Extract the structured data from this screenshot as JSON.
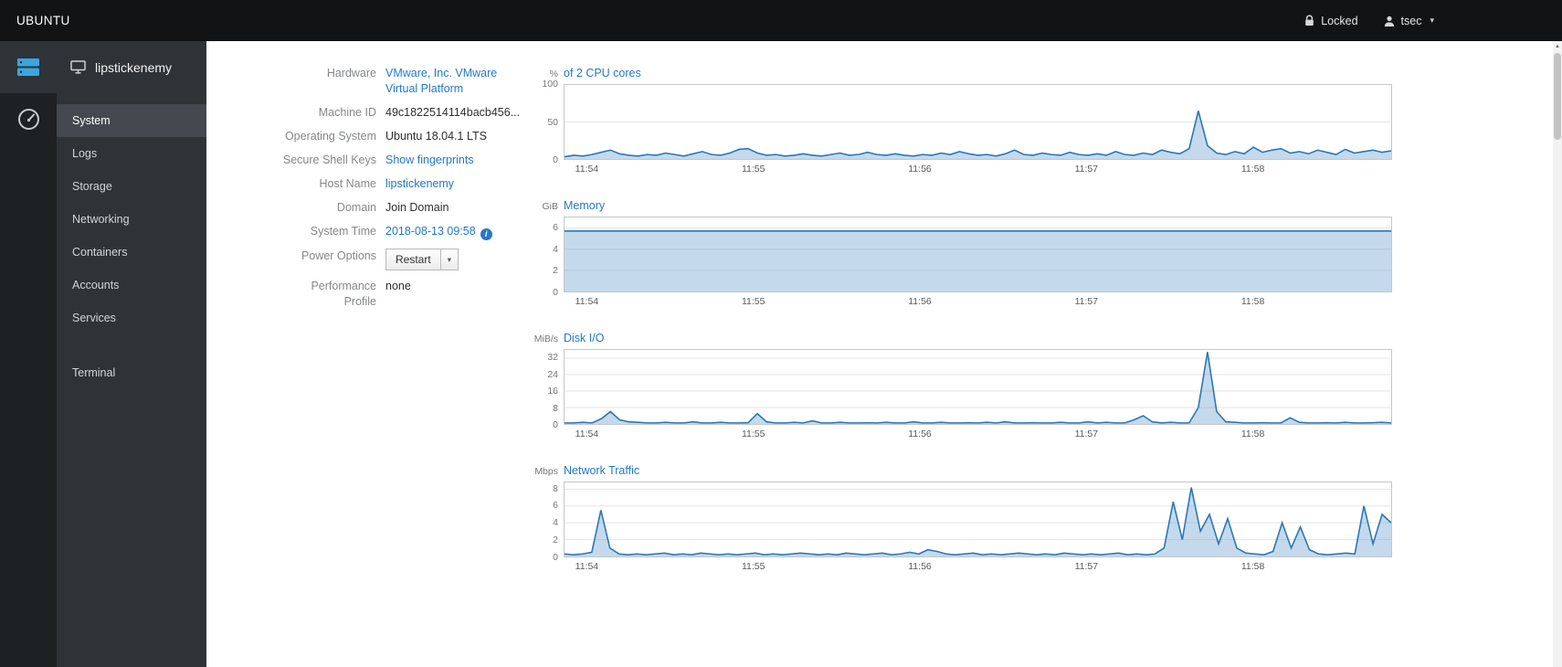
{
  "masthead": {
    "brand": "UBUNTU",
    "locked": "Locked",
    "user": "tsec"
  },
  "sidebar": {
    "host": "lipstickenemy",
    "items": [
      {
        "label": "System",
        "active": true
      },
      {
        "label": "Logs"
      },
      {
        "label": "Storage"
      },
      {
        "label": "Networking"
      },
      {
        "label": "Containers"
      },
      {
        "label": "Accounts"
      },
      {
        "label": "Services"
      }
    ],
    "tools": [
      {
        "label": "Terminal"
      }
    ]
  },
  "info": {
    "rows": [
      {
        "label": "Hardware",
        "value": "VMware, Inc. VMware Virtual Platform",
        "link": true,
        "wrap": true
      },
      {
        "label": "Machine ID",
        "value": "49c1822514114bacb456..."
      },
      {
        "label": "Operating System",
        "value": "Ubuntu 18.04.1 LTS"
      },
      {
        "label": "Secure Shell Keys",
        "value": "Show fingerprints",
        "link": true
      },
      {
        "label": "Host Name",
        "value": "lipstickenemy",
        "link": true
      },
      {
        "label": "Domain",
        "value": "Join Domain"
      },
      {
        "label": "System Time",
        "value": "2018-08-13 09:58",
        "link": true,
        "info_icon": true
      },
      {
        "label": "Power Options",
        "button": "Restart"
      },
      {
        "label": "Performance Profile",
        "value": "none"
      }
    ]
  },
  "colors": {
    "accent_blue": "#2478c8",
    "chart_line": "#2b77b5",
    "chart_fill": "rgba(59,134,192,0.30)",
    "gridline": "rgba(110,110,110,0.18)"
  },
  "chart_data": [
    {
      "id": "cpu",
      "type": "area",
      "unit": "%",
      "title": "of 2 CPU cores",
      "ymax": 100,
      "yticks": [
        0,
        50,
        100
      ],
      "x_labels": [
        "11:54",
        "11:55",
        "11:56",
        "11:57",
        "11:58"
      ],
      "x_label_fracs": [
        0.028,
        0.229,
        0.43,
        0.631,
        0.832
      ],
      "values": [
        3,
        5,
        4,
        6,
        9,
        12,
        7,
        5,
        4,
        6,
        5,
        8,
        6,
        4,
        7,
        10,
        6,
        5,
        8,
        13,
        14,
        8,
        5,
        6,
        4,
        5,
        7,
        5,
        4,
        6,
        8,
        5,
        6,
        9,
        6,
        5,
        7,
        5,
        4,
        6,
        5,
        8,
        6,
        10,
        7,
        5,
        6,
        4,
        7,
        12,
        6,
        5,
        8,
        6,
        5,
        9,
        6,
        5,
        7,
        5,
        10,
        6,
        5,
        8,
        6,
        12,
        9,
        7,
        14,
        65,
        18,
        8,
        6,
        10,
        7,
        16,
        9,
        12,
        14,
        8,
        10,
        7,
        12,
        9,
        6,
        13,
        8,
        10,
        12,
        9,
        11
      ]
    },
    {
      "id": "memory",
      "type": "area",
      "unit": "GiB",
      "title": "Memory",
      "ymax": 7,
      "yticks": [
        0,
        2,
        4,
        6
      ],
      "x_labels": [
        "11:54",
        "11:55",
        "11:56",
        "11:57",
        "11:58"
      ],
      "x_label_fracs": [
        0.028,
        0.229,
        0.43,
        0.631,
        0.832
      ],
      "points": [
        [
          0,
          5.72
        ],
        [
          1,
          5.72
        ]
      ]
    },
    {
      "id": "disk-io",
      "type": "area",
      "unit": "MiB/s",
      "title": "Disk I/O",
      "ymax": 36,
      "yticks": [
        0,
        8,
        16,
        24,
        32
      ],
      "x_labels": [
        "11:54",
        "11:55",
        "11:56",
        "11:57",
        "11:58"
      ],
      "x_label_fracs": [
        0.028,
        0.229,
        0.43,
        0.631,
        0.832
      ],
      "values": [
        0.5,
        0.5,
        0.8,
        0.5,
        2.5,
        6,
        2,
        1,
        0.8,
        0.5,
        0.5,
        0.8,
        0.5,
        0.5,
        1,
        0.5,
        0.5,
        0.8,
        0.5,
        0.5,
        0.6,
        5,
        1,
        0.5,
        0.5,
        0.8,
        0.5,
        1.5,
        0.5,
        0.5,
        0.8,
        0.5,
        0.5,
        0.6,
        0.5,
        0.8,
        0.5,
        0.5,
        1,
        0.5,
        0.5,
        0.8,
        0.5,
        0.5,
        0.6,
        0.5,
        0.8,
        0.5,
        1,
        0.5,
        0.5,
        0.6,
        0.5,
        0.5,
        0.8,
        0.5,
        0.5,
        1,
        0.5,
        0.8,
        0.5,
        0.5,
        2,
        4,
        1,
        0.5,
        0.8,
        0.5,
        0.5,
        8,
        35,
        6,
        1,
        0.8,
        0.5,
        0.5,
        0.6,
        0.5,
        0.5,
        3,
        0.8,
        0.5,
        0.5,
        0.6,
        0.5,
        0.8,
        0.5,
        0.5,
        0.6,
        0.8,
        0.5
      ]
    },
    {
      "id": "network",
      "type": "area",
      "unit": "Mbps",
      "title": "Network Traffic",
      "ymax": 8.8,
      "yticks": [
        0,
        2,
        4,
        6,
        8
      ],
      "x_labels": [
        "11:54",
        "11:55",
        "11:56",
        "11:57",
        "11:58"
      ],
      "x_label_fracs": [
        0.028,
        0.229,
        0.43,
        0.631,
        0.832
      ],
      "values": [
        0.3,
        0.2,
        0.3,
        0.5,
        5.5,
        1,
        0.3,
        0.2,
        0.3,
        0.2,
        0.3,
        0.4,
        0.2,
        0.3,
        0.2,
        0.4,
        0.3,
        0.2,
        0.3,
        0.2,
        0.3,
        0.4,
        0.2,
        0.3,
        0.2,
        0.3,
        0.4,
        0.3,
        0.2,
        0.3,
        0.2,
        0.4,
        0.3,
        0.2,
        0.3,
        0.4,
        0.2,
        0.3,
        0.5,
        0.3,
        0.8,
        0.6,
        0.3,
        0.2,
        0.3,
        0.4,
        0.2,
        0.3,
        0.2,
        0.3,
        0.4,
        0.3,
        0.2,
        0.3,
        0.2,
        0.4,
        0.3,
        0.2,
        0.3,
        0.2,
        0.3,
        0.4,
        0.2,
        0.3,
        0.2,
        0.3,
        1,
        6.5,
        2,
        8.2,
        3,
        5,
        1.5,
        4.5,
        1,
        0.4,
        0.3,
        0.2,
        0.6,
        4,
        1,
        3.5,
        0.8,
        0.3,
        0.2,
        0.3,
        0.4,
        0.3,
        6,
        1.5,
        5,
        4
      ]
    }
  ]
}
